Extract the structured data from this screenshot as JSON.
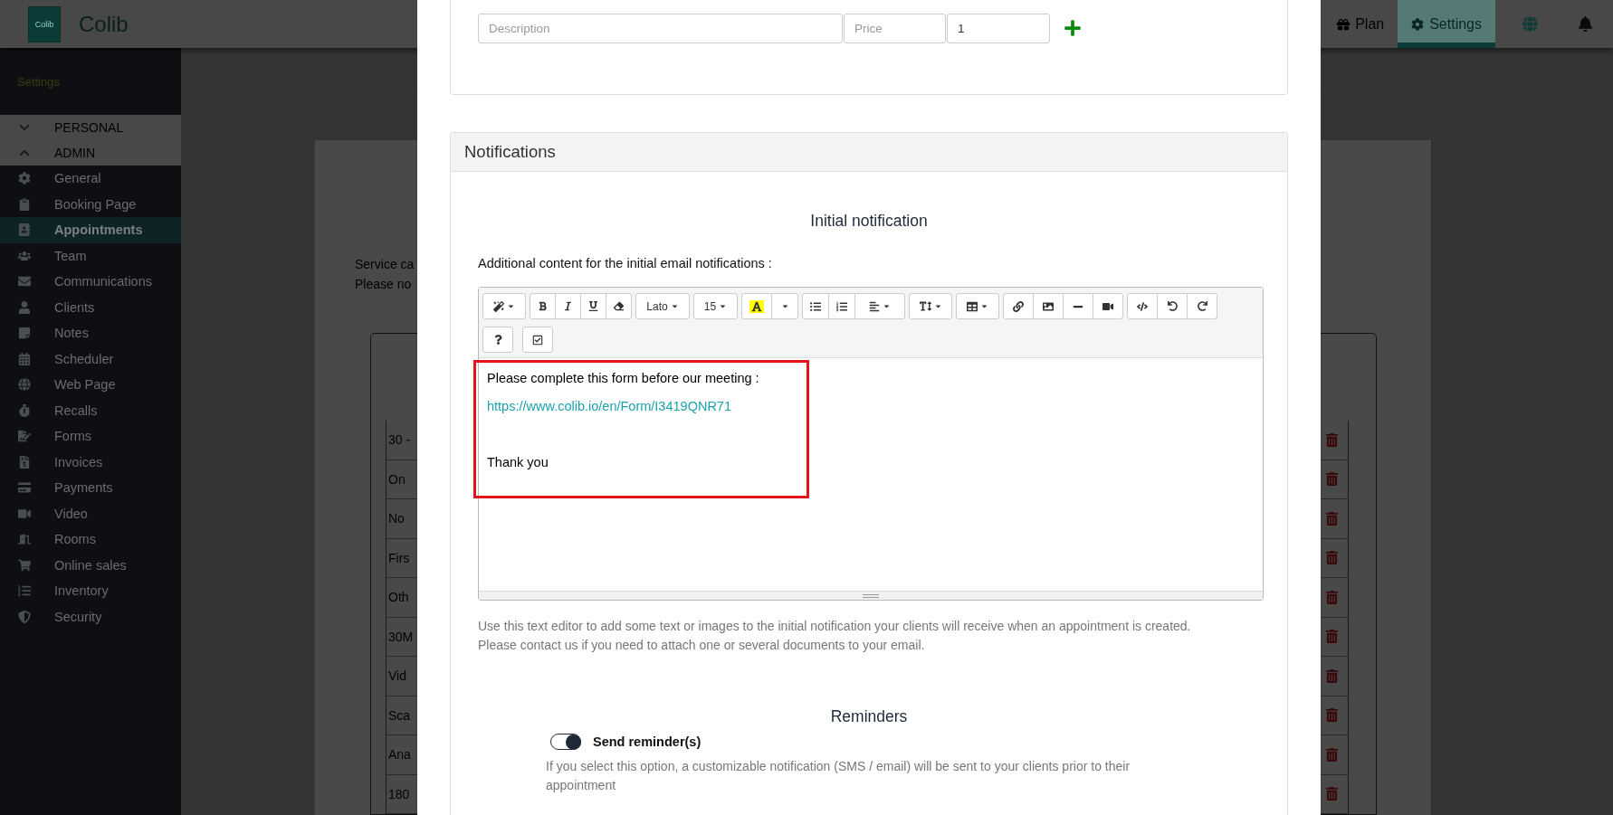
{
  "header": {
    "brand": "Colib",
    "logo_text": "Colib",
    "nav": [
      {
        "label": "Plan",
        "selected": false
      },
      {
        "label": "Settings",
        "selected": true
      }
    ]
  },
  "sidebar": {
    "title": "Settings",
    "sections": [
      {
        "label": "PERSONAL",
        "expanded": false
      },
      {
        "label": "ADMIN",
        "expanded": true
      }
    ],
    "items": [
      {
        "label": "General",
        "selected": false
      },
      {
        "label": "Booking Page",
        "selected": false
      },
      {
        "label": "Appointments",
        "selected": true
      },
      {
        "label": "Team",
        "selected": false
      },
      {
        "label": "Communications",
        "selected": false
      },
      {
        "label": "Clients",
        "selected": false
      },
      {
        "label": "Notes",
        "selected": false
      },
      {
        "label": "Scheduler",
        "selected": false
      },
      {
        "label": "Web Page",
        "selected": false
      },
      {
        "label": "Recalls",
        "selected": false
      },
      {
        "label": "Forms",
        "selected": false
      },
      {
        "label": "Invoices",
        "selected": false
      },
      {
        "label": "Payments",
        "selected": false
      },
      {
        "label": "Video",
        "selected": false
      },
      {
        "label": "Rooms",
        "selected": false
      },
      {
        "label": "Online sales",
        "selected": false
      },
      {
        "label": "Inventory",
        "selected": false
      },
      {
        "label": "Security",
        "selected": false
      }
    ]
  },
  "page_behind": {
    "intro": [
      "Service ca",
      "Please no"
    ],
    "rows": [
      "30 -",
      "On",
      "No",
      "Firs",
      "Oth",
      "30M",
      "Vid",
      "Sca",
      "Ana",
      "180"
    ]
  },
  "modal": {
    "line_item": {
      "description_placeholder": "Description",
      "price_placeholder": "Price",
      "quantity": "1"
    },
    "notifications": {
      "title": "Notifications",
      "initial": {
        "heading": "Initial notification",
        "label": "Additional content for the initial email notifications :",
        "toolbar": {
          "font": "Lato",
          "size": "15"
        },
        "content": [
          {
            "kind": "text",
            "text": "Please complete this form before our meeting :"
          },
          {
            "kind": "link",
            "text": "https://www.colib.io/en/Form/I3419QNR71"
          },
          {
            "kind": "blank"
          },
          {
            "kind": "text",
            "text": "Thank you"
          }
        ],
        "help": [
          "Use this text editor to add some text or images to the initial notification your clients will receive when an appointment is created.",
          "Please contact us if you need to attach one or several documents to your email."
        ]
      },
      "reminders": {
        "heading": "Reminders",
        "toggle": {
          "label": "Send reminder(s)",
          "on": true
        },
        "description": "If you select this option, a customizable notification (SMS / email) will be sent to your clients prior to their appointment"
      }
    }
  }
}
